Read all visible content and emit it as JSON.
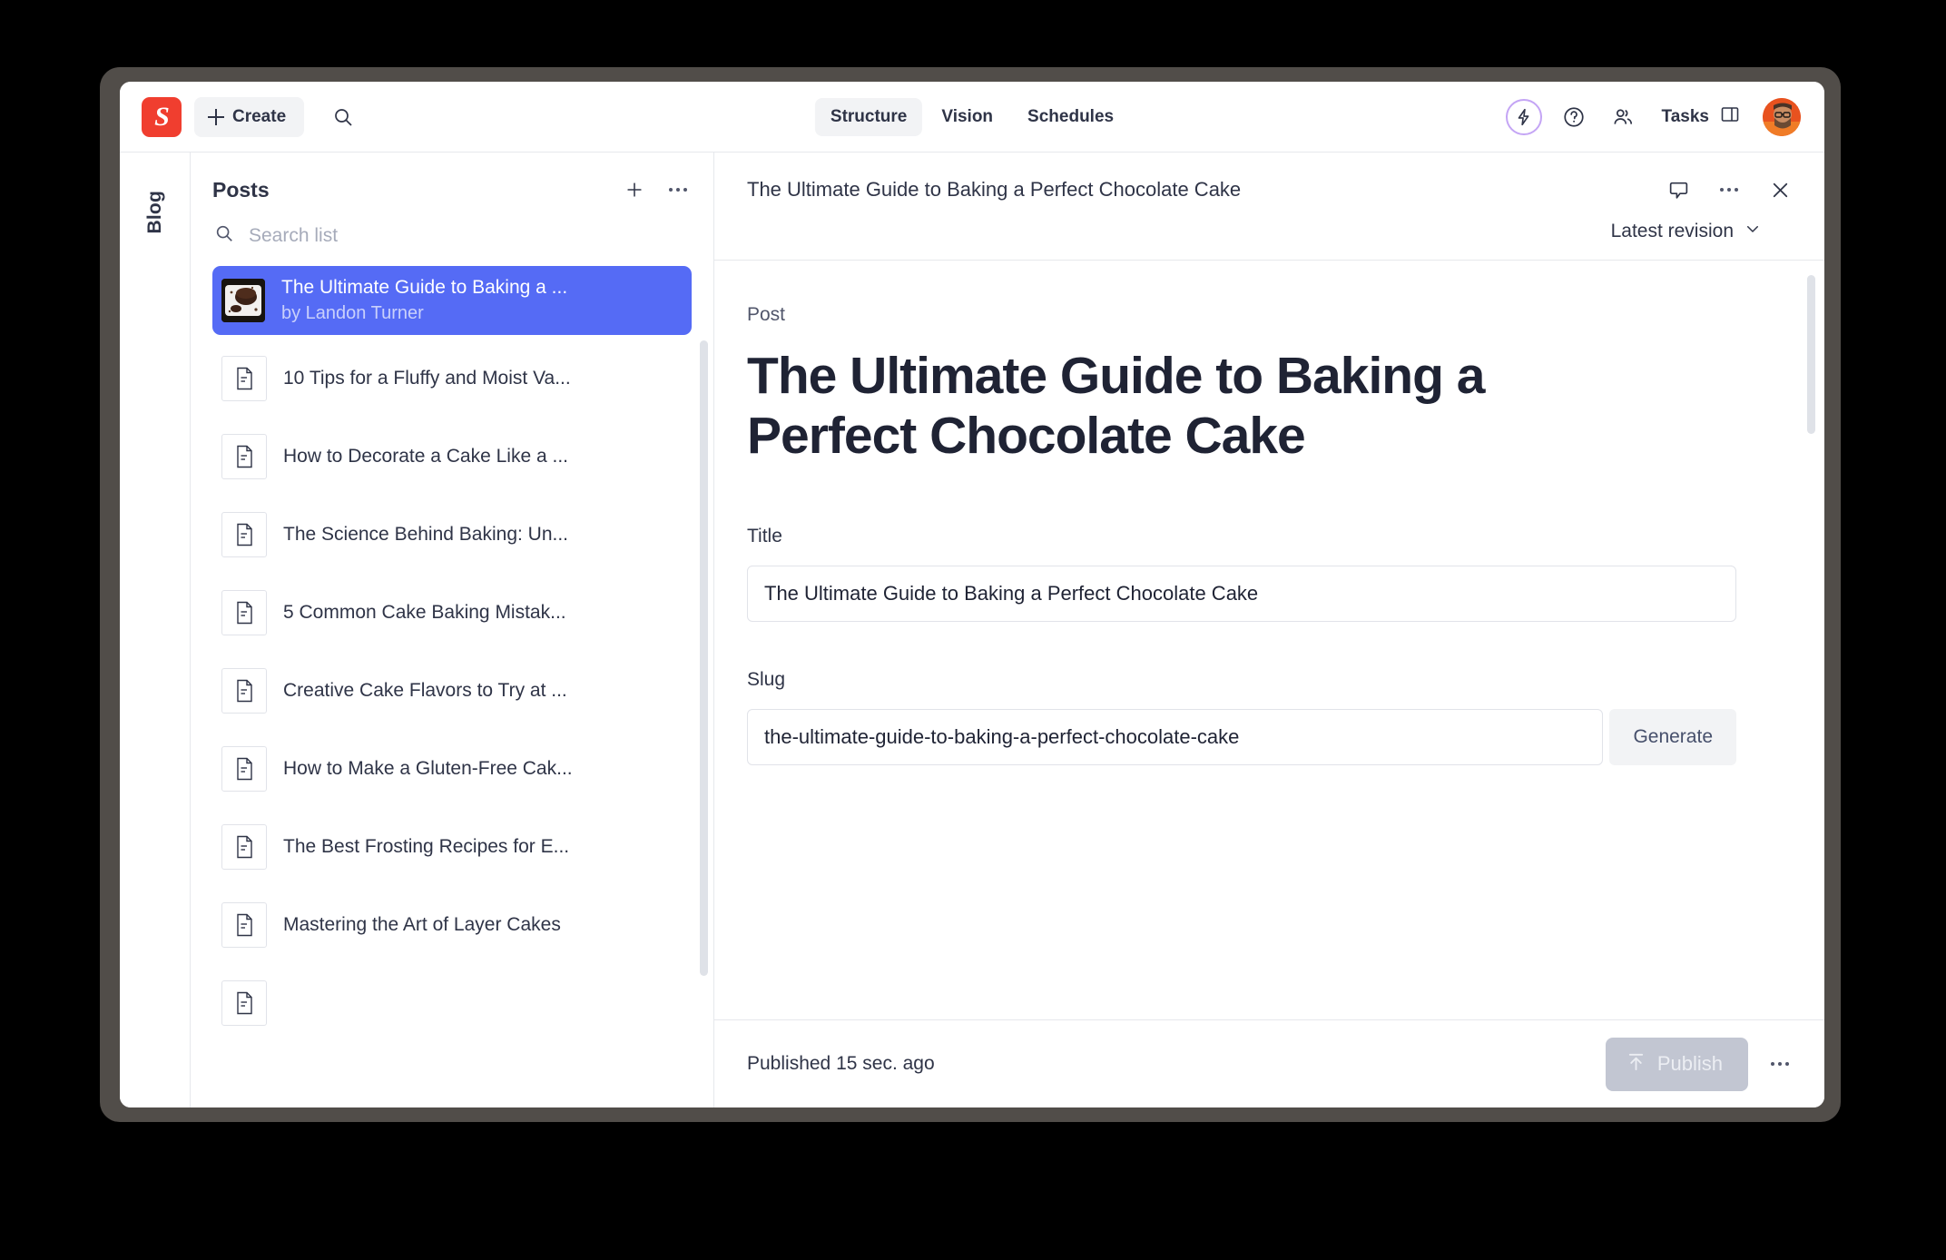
{
  "navbar": {
    "logo_letter": "S",
    "logo_name": "sanity-logo",
    "create_label": "Create",
    "search_icon": "search-icon",
    "tabs": [
      {
        "label": "Structure",
        "active": true
      },
      {
        "label": "Vision",
        "active": false
      },
      {
        "label": "Schedules",
        "active": false
      }
    ],
    "upgrade_icon": "lightning-bolt-icon",
    "help_icon": "question-circle-icon",
    "manage_icon": "users-icon",
    "tasks_label": "Tasks",
    "tasks_panel_icon": "panel-layout-icon",
    "avatar_name": "user-avatar"
  },
  "rail": {
    "label": "Blog"
  },
  "posts_pane": {
    "title": "Posts",
    "add_icon": "plus-icon",
    "more_icon": "ellipsis-icon",
    "search_placeholder": "Search list",
    "search_value": "",
    "items": [
      {
        "title": "The Ultimate Guide to Baking a ...",
        "subtitle": "by Landon Turner",
        "selected": true,
        "thumb": "chocolate-cake-photo"
      },
      {
        "title": "10 Tips for a Fluffy and Moist Va...",
        "subtitle": "",
        "selected": false,
        "thumb": "document-icon"
      },
      {
        "title": "How to Decorate a Cake Like a ...",
        "subtitle": "",
        "selected": false,
        "thumb": "document-icon"
      },
      {
        "title": "The Science Behind Baking: Un...",
        "subtitle": "",
        "selected": false,
        "thumb": "document-icon"
      },
      {
        "title": "5 Common Cake Baking Mistak...",
        "subtitle": "",
        "selected": false,
        "thumb": "document-icon"
      },
      {
        "title": "Creative Cake Flavors to Try at ...",
        "subtitle": "",
        "selected": false,
        "thumb": "document-icon"
      },
      {
        "title": "How to Make a Gluten-Free Cak...",
        "subtitle": "",
        "selected": false,
        "thumb": "document-icon"
      },
      {
        "title": "The Best Frosting Recipes for E...",
        "subtitle": "",
        "selected": false,
        "thumb": "document-icon"
      },
      {
        "title": "Mastering the Art of Layer Cakes",
        "subtitle": "",
        "selected": false,
        "thumb": "document-icon"
      }
    ]
  },
  "document": {
    "header_title": "The Ultimate Guide to Baking a Perfect Chocolate Cake",
    "comment_icon": "comment-icon",
    "more_icon": "ellipsis-icon",
    "close_icon": "close-icon",
    "revision_label": "Latest revision",
    "revision_chevron": "chevron-down-icon",
    "type_label": "Post",
    "main_title": "The Ultimate Guide to Baking a Perfect Chocolate Cake",
    "fields": [
      {
        "label": "Title",
        "value": "The Ultimate Guide to Baking a Perfect Chocolate Cake",
        "placeholder": ""
      },
      {
        "label": "Slug",
        "value": "the-ultimate-guide-to-baking-a-perfect-chocolate-cake",
        "placeholder": "",
        "action_label": "Generate"
      }
    ],
    "footer": {
      "status": "Published 15 sec. ago",
      "publish_label": "Publish",
      "publish_icon": "publish-arrow-icon",
      "more_icon": "ellipsis-icon"
    }
  },
  "colors": {
    "brand_red": "#f03e2f",
    "selection_blue": "#556bf5",
    "accent_purple": "#c4a5f5",
    "text_primary": "#2f3447",
    "border": "#e6e8ec"
  }
}
